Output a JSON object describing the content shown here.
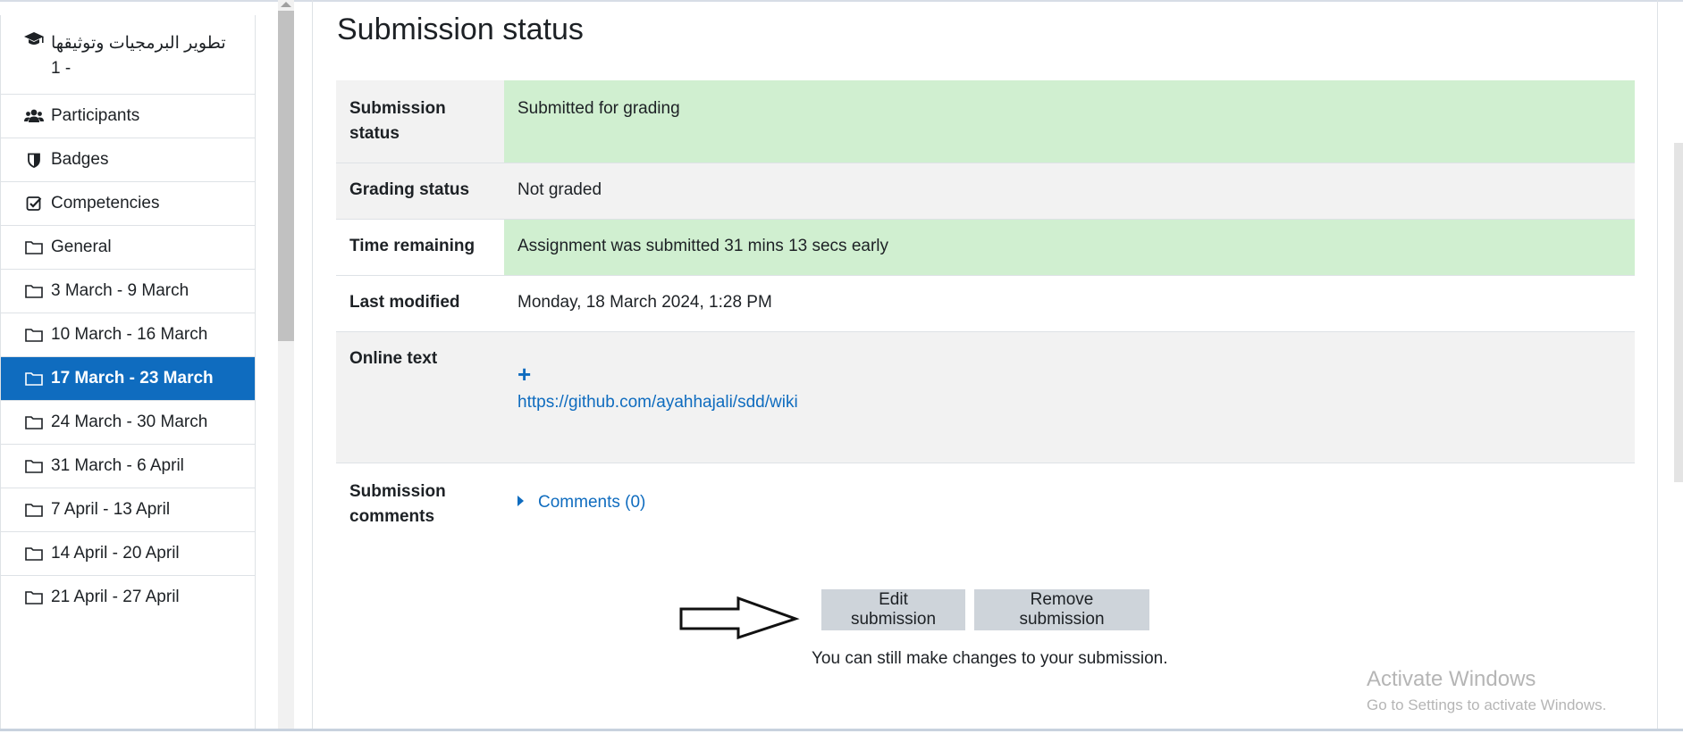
{
  "sidebar": {
    "course": {
      "title_line1": "تطوير البرمجيات وتوثيقها",
      "title_line2": "1 -"
    },
    "items": [
      {
        "label": "Participants",
        "icon": "users-icon"
      },
      {
        "label": "Badges",
        "icon": "shield-icon"
      },
      {
        "label": "Competencies",
        "icon": "check-square-icon"
      },
      {
        "label": "General",
        "icon": "folder-icon"
      },
      {
        "label": "3 March - 9 March",
        "icon": "folder-icon"
      },
      {
        "label": "10 March - 16 March",
        "icon": "folder-icon"
      },
      {
        "label": "17 March - 23 March",
        "icon": "folder-icon",
        "active": true
      },
      {
        "label": "24 March - 30 March",
        "icon": "folder-icon"
      },
      {
        "label": "31 March - 6 April",
        "icon": "folder-icon"
      },
      {
        "label": "7 April - 13 April",
        "icon": "folder-icon"
      },
      {
        "label": "14 April - 20 April",
        "icon": "folder-icon"
      },
      {
        "label": "21 April - 27 April",
        "icon": "folder-icon"
      }
    ]
  },
  "main": {
    "heading": "Submission status",
    "rows": {
      "submission_status": {
        "label_line1": "Submission",
        "label_line2": "status",
        "value": "Submitted for grading"
      },
      "grading_status": {
        "label": "Grading status",
        "value": "Not graded"
      },
      "time_remaining": {
        "label": "Time remaining",
        "value": "Assignment was submitted 31 mins 13 secs early"
      },
      "last_modified": {
        "label": "Last modified",
        "value": "Monday, 18 March 2024, 1:28 PM"
      },
      "online_text": {
        "label": "Online text",
        "plus": "+",
        "link": "https://github.com/ayahhajali/sdd/wiki"
      },
      "submission_comments": {
        "label_line1": "Submission",
        "label_line2": "comments",
        "link": "Comments (0)"
      }
    },
    "buttons": {
      "edit": "Edit submission",
      "remove": "Remove submission"
    },
    "note": "You can still make changes to your submission."
  },
  "watermark": {
    "title": "Activate Windows",
    "subtitle": "Go to Settings to activate Windows."
  },
  "colors": {
    "accent": "#0f6cbf",
    "success_bg": "#d0efd0",
    "button_bg": "#ced4da"
  }
}
